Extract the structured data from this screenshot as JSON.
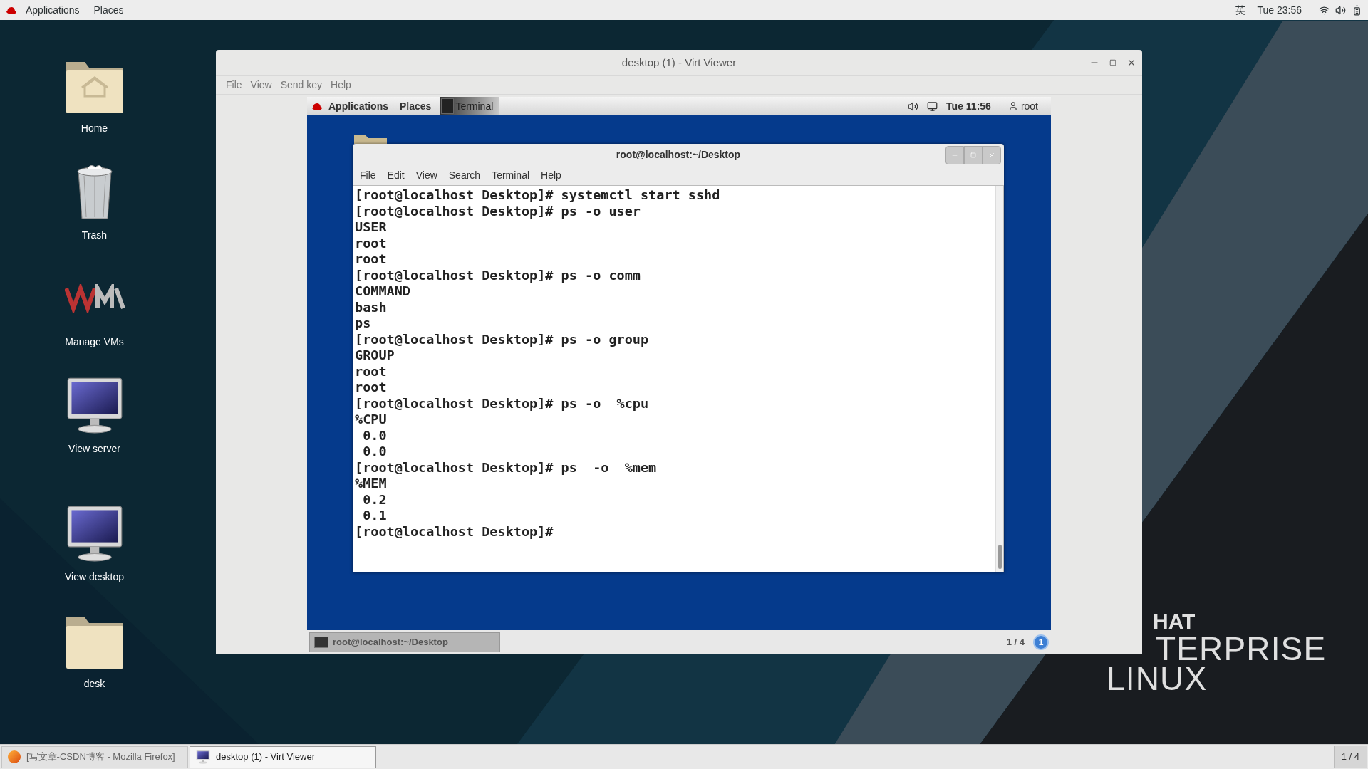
{
  "top_bar": {
    "menus": [
      "Applications",
      "Places"
    ],
    "input_method": "英",
    "clock": "Tue 23:56"
  },
  "desktop_icons": [
    {
      "kind": "home",
      "label": "Home"
    },
    {
      "kind": "trash",
      "label": "Trash"
    },
    {
      "kind": "vm",
      "label": "Manage VMs"
    },
    {
      "kind": "monitor",
      "label": "View server"
    },
    {
      "kind": "monitor",
      "label": "View desktop"
    },
    {
      "kind": "folder",
      "label": "desk"
    }
  ],
  "viewer": {
    "title": "desktop (1) - Virt Viewer",
    "menu": [
      "File",
      "View",
      "Send key",
      "Help"
    ],
    "guest": {
      "top_bar": {
        "menus": [
          "Applications",
          "Places"
        ],
        "task": "Terminal",
        "clock": "Tue 11:56",
        "user": "root"
      },
      "terminal": {
        "title": "root@localhost:~/Desktop",
        "menu": [
          "File",
          "Edit",
          "View",
          "Search",
          "Terminal",
          "Help"
        ],
        "lines": [
          "[root@localhost Desktop]# systemctl start sshd",
          "[root@localhost Desktop]# ps -o user",
          "USER",
          "root",
          "root",
          "[root@localhost Desktop]# ps -o comm",
          "COMMAND",
          "bash",
          "ps",
          "[root@localhost Desktop]# ps -o group",
          "GROUP",
          "root",
          "root",
          "[root@localhost Desktop]# ps -o  %cpu",
          "%CPU",
          " 0.0",
          " 0.0",
          "[root@localhost Desktop]# ps  -o  %mem",
          "%MEM",
          " 0.2",
          " 0.1",
          "[root@localhost Desktop]#"
        ]
      },
      "bottom_bar": {
        "task": "root@localhost:~/Desktop",
        "workspace": "1 / 4",
        "notification_count": "1"
      }
    }
  },
  "logo": [
    "HAT",
    "TERPRISE",
    "LINUX"
  ],
  "taskbar": {
    "tasks": [
      {
        "label": "[写文章-CSDN博客 - Mozilla Firefox]",
        "kind": "browser",
        "selected": false
      },
      {
        "label": "desktop (1) - Virt Viewer",
        "kind": "monitor",
        "selected": true
      }
    ],
    "workspace": "1 / 4"
  }
}
